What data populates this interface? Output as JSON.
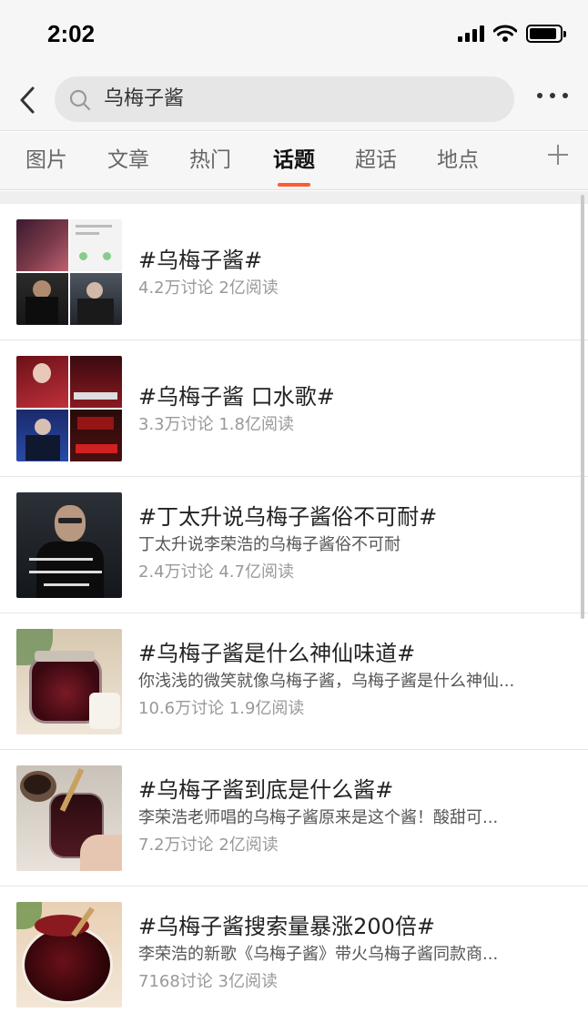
{
  "status": {
    "time": "2:02",
    "battery_level": 0.9
  },
  "search": {
    "query": "乌梅子酱"
  },
  "tabs": [
    {
      "label": "图片",
      "active": false
    },
    {
      "label": "文章",
      "active": false
    },
    {
      "label": "热门",
      "active": false
    },
    {
      "label": "话题",
      "active": true
    },
    {
      "label": "超话",
      "active": false
    },
    {
      "label": "地点",
      "active": false
    }
  ],
  "topics": [
    {
      "title": "#乌梅子酱#",
      "desc": "",
      "stats": "4.2万讨论 2亿阅读"
    },
    {
      "title": "#乌梅子酱 口水歌#",
      "desc": "",
      "stats": "3.3万讨论 1.8亿阅读"
    },
    {
      "title": "#丁太升说乌梅子酱俗不可耐#",
      "desc": "丁太升说李荣浩的乌梅子酱俗不可耐",
      "stats": "2.4万讨论 4.7亿阅读"
    },
    {
      "title": "#乌梅子酱是什么神仙味道#",
      "desc": "你浅浅的微笑就像乌梅子酱，乌梅子酱是什么神仙...",
      "stats": "10.6万讨论 1.9亿阅读"
    },
    {
      "title": "#乌梅子酱到底是什么酱#",
      "desc": "李荣浩老师唱的乌梅子酱原来是这个酱！酸甜可...",
      "stats": "7.2万讨论 2亿阅读"
    },
    {
      "title": "#乌梅子酱搜索量暴涨200倍#",
      "desc": "李荣浩的新歌《乌梅子酱》带火乌梅子酱同款商...",
      "stats": "7168讨论 3亿阅读"
    }
  ],
  "colors": {
    "accent": "#ff5b2c",
    "bar_bg": "#f6f6f6"
  }
}
